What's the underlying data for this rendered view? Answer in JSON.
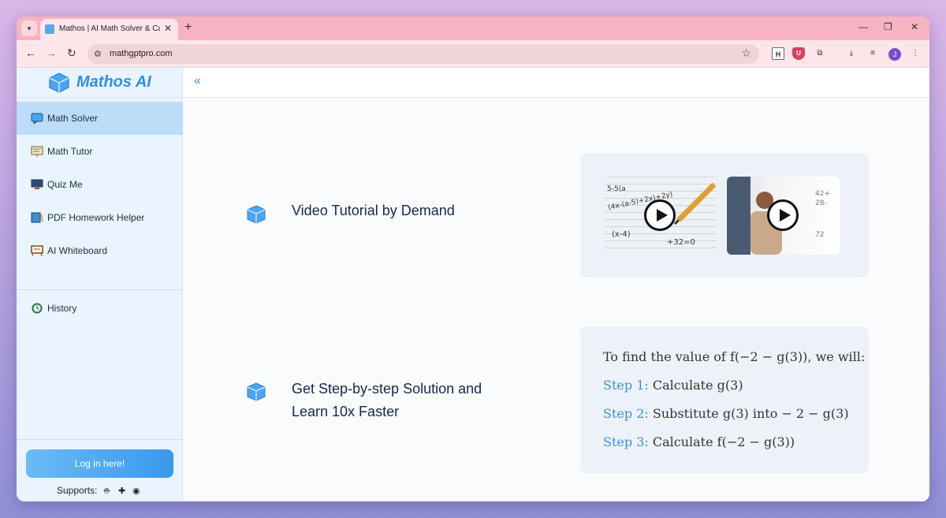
{
  "browser": {
    "tab_title": "Mathos | AI Math Solver & Calc",
    "tab_close": "✕",
    "new_tab": "+",
    "url": "mathgptpro.com",
    "avatar_initial": "J",
    "ext_h_label": "H",
    "ext_shield_label": "U"
  },
  "sidebar": {
    "brand": "Mathos AI",
    "items": [
      {
        "label": "Math Solver",
        "icon": "chat-bubble-icon"
      },
      {
        "label": "Math Tutor",
        "icon": "tutor-board-icon"
      },
      {
        "label": "Quiz Me",
        "icon": "monitor-icon"
      },
      {
        "label": "PDF Homework Helper",
        "icon": "book-pen-icon"
      },
      {
        "label": "AI Whiteboard",
        "icon": "whiteboard-icon"
      },
      {
        "label": "History",
        "icon": "clock-icon"
      }
    ],
    "login_label": "Log in here!",
    "supports_label": "Supports:"
  },
  "main": {
    "collapse_glyph": "«",
    "feature1": {
      "title": "Video Tutorial by Demand"
    },
    "feature2": {
      "title_line1": "Get Step-by-step Solution and",
      "title_line2": "Learn 10x Faster"
    },
    "solution": {
      "intro": "To find the value of f(−2 − g(3)),  we will:",
      "steps": [
        {
          "label": "Step 1:",
          "text": "Calculate g(3)"
        },
        {
          "label": "Step 2:",
          "text": "Substitute g(3) into  − 2 − g(3)"
        },
        {
          "label": "Step 3:",
          "text": "Calculate f(−2 − g(3))"
        }
      ]
    }
  },
  "colors": {
    "accent": "#3a8fdc",
    "tabstrip": "#f6b3c0",
    "sidebar_bg": "#e9f4fe"
  }
}
